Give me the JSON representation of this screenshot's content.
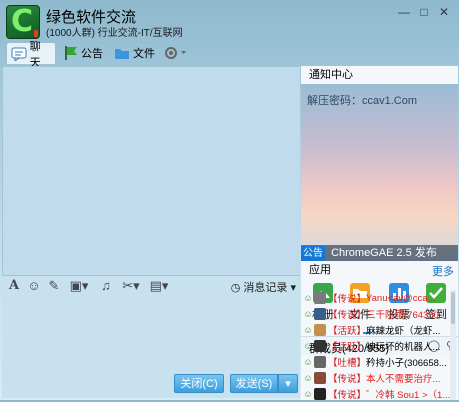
{
  "window": {
    "group_name": "绿色软件交流",
    "group_sub": "(1000人群) 行业交流-IT/互联网",
    "minimize_glyph": "—",
    "maximize_glyph": "□",
    "close_glyph": "✕"
  },
  "tabs": [
    {
      "label": "聊天",
      "icon": "chat-bubble-icon"
    },
    {
      "label": "公告",
      "icon": "flag-icon"
    },
    {
      "label": "文件",
      "icon": "folder-icon"
    }
  ],
  "input_toolbar": {
    "history_label": "消息记录"
  },
  "buttons": {
    "close_label": "关闭(C)",
    "send_label": "发送(S)"
  },
  "notice": {
    "title": "通知中心",
    "password_text": "解压密码：ccav1.Com",
    "caption_badge": "公告",
    "caption_text": "ChromeGAE 2.5 发布"
  },
  "apps": {
    "title": "应用",
    "more_label": "更多",
    "items": [
      {
        "label": "相册",
        "color": "#3aa64b"
      },
      {
        "label": "文件",
        "color": "#f2a323"
      },
      {
        "label": "投票",
        "color": "#2f8ee0"
      },
      {
        "label": "签到",
        "color": "#3fae3a"
      }
    ]
  },
  "members": {
    "title": "群成员(420/955)",
    "list": [
      {
        "role": "【传说】",
        "name": "Yanu<av@cca...",
        "name_red": true,
        "color": "#7a7a7a"
      },
      {
        "role": "【传说】",
        "name": "三千院雨(764350...",
        "name_red": true,
        "color": "#3a5d8a"
      },
      {
        "role": "【活跃】",
        "name": "麻辣龙虾（龙虾...",
        "name_red": false,
        "color": "#c49050"
      },
      {
        "role": "【活跃】",
        "name": "被玩坏的机器人...",
        "name_red": false,
        "color": "#333333"
      },
      {
        "role": "【吐槽】",
        "name": "矜持小子(306658...",
        "name_red": false,
        "color": "#666666"
      },
      {
        "role": "【传说】",
        "name": "本人不需要治疗...",
        "name_red": true,
        "color": "#8a4a3a"
      },
      {
        "role": "【传说】",
        "name": "゛冷韩 Sou1 >（1...",
        "name_red": true,
        "color": "#222222"
      }
    ]
  }
}
